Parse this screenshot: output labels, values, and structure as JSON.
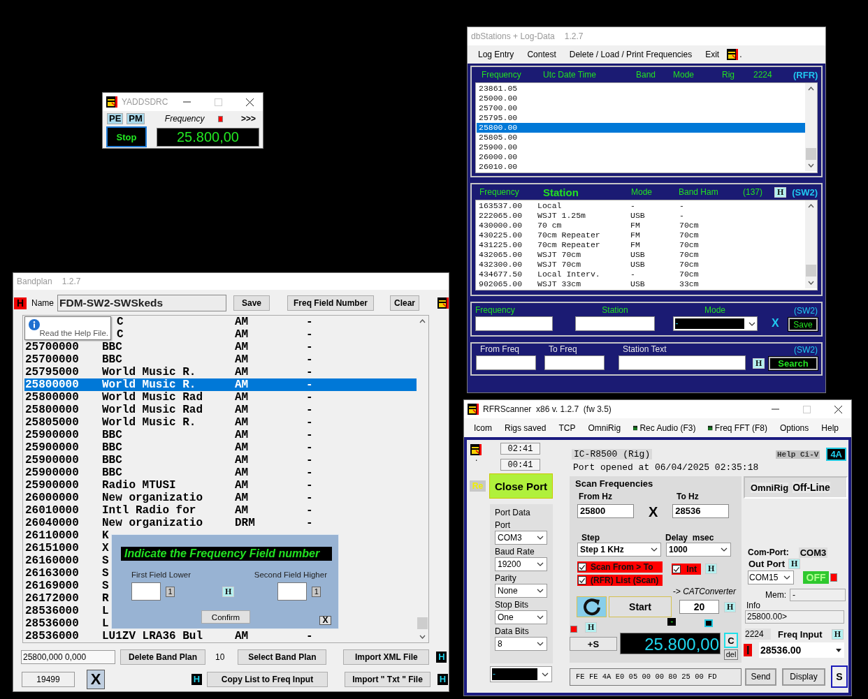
{
  "yaddsdrc": {
    "title": "YADDSDRC",
    "modes": [
      "PE",
      "PM"
    ],
    "frequency_label": "Frequency",
    "more": ">>>",
    "stop": "Stop",
    "frequency": "25.800,00"
  },
  "dbstations": {
    "title": "dbStations + Log-Data",
    "version": "1.2.7",
    "menu": [
      "Log Entry",
      "Contest",
      "Delete / Load / Print Frequencies",
      "Exit"
    ],
    "menu_mark": ".",
    "log": {
      "columns": [
        "Frequency",
        "Utc Date Time",
        "Band",
        "Mode",
        "Rig",
        "2224"
      ],
      "tag": "(RFR)",
      "rows": [
        {
          "frequency": "23861.05",
          "selected": false
        },
        {
          "frequency": "25000.00",
          "selected": false
        },
        {
          "frequency": "25700.00",
          "selected": false
        },
        {
          "frequency": "25795.00",
          "selected": false
        },
        {
          "frequency": "25800.00",
          "selected": true
        },
        {
          "frequency": "25805.00",
          "selected": false
        },
        {
          "frequency": "25900.00",
          "selected": false
        },
        {
          "frequency": "26000.00",
          "selected": false
        },
        {
          "frequency": "26010.00",
          "selected": false
        }
      ]
    },
    "stations": {
      "columns": [
        "Frequency",
        "Station",
        "Mode",
        "Band Ham",
        "(137)"
      ],
      "help": "H",
      "tag": "(SW2)",
      "rows": [
        {
          "frequency": "163537.00",
          "station": "Local",
          "mode": "-",
          "band": "-"
        },
        {
          "frequency": "222065.00",
          "station": "WSJT 1.25m",
          "mode": "USB",
          "band": "-"
        },
        {
          "frequency": "430000.00",
          "station": "70 cm",
          "mode": "FM",
          "band": "70cm"
        },
        {
          "frequency": "430225.00",
          "station": "70cm Repeater",
          "mode": "FM",
          "band": "70cm"
        },
        {
          "frequency": "431225.00",
          "station": "70cm Repeater",
          "mode": "FM",
          "band": "70cm"
        },
        {
          "frequency": "432065.00",
          "station": "WSJT 70cm",
          "mode": "USB",
          "band": "70cm"
        },
        {
          "frequency": "432300.00",
          "station": "WSJT 70cm",
          "mode": "USB",
          "band": "70cm"
        },
        {
          "frequency": "434677.50",
          "station": "Local Interv.",
          "mode": "-",
          "band": "70cm"
        },
        {
          "frequency": "902065.00",
          "station": "WSJT 33cm",
          "mode": "USB",
          "band": "33cm"
        }
      ]
    },
    "entry": {
      "frequency_label": "Frequency",
      "station_label": "Station",
      "mode_label": "Mode",
      "mode_value": "-",
      "clear": "X",
      "save": "Save",
      "tag": "(SW2)"
    },
    "search": {
      "from_label": "From Freq",
      "to_label": "To Freq",
      "text_label": "Station Text",
      "help": "H",
      "button": "Search",
      "tag": "(SW2)"
    }
  },
  "bandplan": {
    "title": "Bandplan",
    "version": "1.2.7",
    "help": "H",
    "name_label": "Name",
    "name_value": "FDM-SW2-SWSkeds",
    "buttons": [
      "Save",
      "Freq Field Number",
      "Clear"
    ],
    "rows": [
      {
        "station": "C",
        "mode": "AM",
        "band": "-",
        "selected": false
      },
      {
        "station": "C",
        "mode": "AM",
        "band": "-",
        "selected": false
      },
      {
        "frequency": "25700000",
        "station": "BBC",
        "mode": "AM",
        "band": "-",
        "selected": false
      },
      {
        "frequency": "25700000",
        "station": "BBC",
        "mode": "AM",
        "band": "-",
        "selected": false
      },
      {
        "frequency": "25795000",
        "station": "World Music R.",
        "mode": "AM",
        "band": "-",
        "selected": false
      },
      {
        "frequency": "25800000",
        "station": "World Music R.",
        "mode": "AM",
        "band": "-",
        "selected": true
      },
      {
        "frequency": "25800000",
        "station": "World Music Rad",
        "mode": "AM",
        "band": "-",
        "selected": false
      },
      {
        "frequency": "25800000",
        "station": "World Music Rad",
        "mode": "AM",
        "band": "-",
        "selected": false
      },
      {
        "frequency": "25805000",
        "station": "World Music R.",
        "mode": "AM",
        "band": "-",
        "selected": false
      },
      {
        "frequency": "25900000",
        "station": "BBC",
        "mode": "AM",
        "band": "-",
        "selected": false
      },
      {
        "frequency": "25900000",
        "station": "BBC",
        "mode": "AM",
        "band": "-",
        "selected": false
      },
      {
        "frequency": "25900000",
        "station": "BBC",
        "mode": "AM",
        "band": "-",
        "selected": false
      },
      {
        "frequency": "25900000",
        "station": "BBC",
        "mode": "AM",
        "band": "-",
        "selected": false
      },
      {
        "frequency": "25900000",
        "station": "Radio MTUSI",
        "mode": "AM",
        "band": "-",
        "selected": false
      },
      {
        "frequency": "26000000",
        "station": "New organizatio",
        "mode": "AM",
        "band": "-",
        "selected": false
      },
      {
        "frequency": "26010000",
        "station": "Intl Radio for",
        "mode": "AM",
        "band": "-",
        "selected": false
      },
      {
        "frequency": "26040000",
        "station": "New organizatio",
        "mode": "DRM",
        "band": "-",
        "selected": false
      },
      {
        "frequency": "26110000",
        "station": "K",
        "selected": false
      },
      {
        "frequency": "26151000",
        "station": "X",
        "selected": false
      },
      {
        "frequency": "26160000",
        "station": "S",
        "selected": false
      },
      {
        "frequency": "26163000",
        "station": "S",
        "selected": false
      },
      {
        "frequency": "26169000",
        "station": "S",
        "selected": false
      },
      {
        "frequency": "26172000",
        "station": "R",
        "selected": false
      },
      {
        "frequency": "28536000",
        "station": "L",
        "selected": false
      },
      {
        "frequency": "28536000",
        "station": "L",
        "selected": false
      },
      {
        "frequency": "28536000",
        "station": "LU1ZV LRA36 Bul",
        "mode": "AM",
        "band": "-",
        "selected": false
      }
    ],
    "tooltip": "Read the Help File.",
    "dialog": {
      "title": "Indicate the Frequency Field number",
      "lower_label": "First Field Lower",
      "higher_label": "Second Field Higher",
      "lower_spin": "1",
      "higher_spin": "1",
      "help": "H",
      "confirm": "Confirm",
      "close": "X"
    },
    "range": "25800,000 0,000",
    "delete": "Delete Band Plan",
    "count": "10",
    "select": "Select Band Plan",
    "import_xml": "Import XML File",
    "xml_help": "H",
    "total": "19499",
    "close": "X",
    "copy_help": "H",
    "copy": "Copy List to Freq Input",
    "import_txt": "Import \" Txt \" File",
    "txt_help": "H"
  },
  "rfrscanner": {
    "title": "RFRScanner  x86 v. 1.2.7  (fw 3.5)",
    "menu": [
      {
        "label": "Icom",
        "kind": "text"
      },
      {
        "label": "Rigs saved",
        "kind": "text"
      },
      {
        "label": "TCP",
        "kind": "text"
      },
      {
        "label": "OmniRig",
        "kind": "text"
      },
      {
        "label": "Rec Audio (F3)",
        "kind": "meter"
      },
      {
        "label": "Freq FFT (F8)",
        "kind": "meter"
      },
      {
        "label": "Options",
        "kind": "text"
      },
      {
        "label": "Help",
        "kind": "text"
      }
    ],
    "logo_mark": ".",
    "timers": [
      "02:41",
      "00:41"
    ],
    "re": "Re",
    "close_port": "Close Port",
    "port_data": {
      "title": "Port Data",
      "fields": [
        {
          "label": "Port",
          "value": "COM3"
        },
        {
          "label": "Baud Rate",
          "value": "19200"
        },
        {
          "label": "Parity",
          "value": "None"
        },
        {
          "label": "Stop Bits",
          "value": "One"
        },
        {
          "label": "Data Bits",
          "value": "8"
        }
      ]
    },
    "bottom_combo": "-",
    "rig": "IC-R8500 (Rig)",
    "status": "Port opened at 06/04/2025 02:35:18",
    "help_civ": "Help Ci-V",
    "address": "4A",
    "scan": {
      "title": "Scan Frequencies",
      "from_label": "From Hz",
      "from": "25800",
      "swap": "X",
      "to_label": "To Hz",
      "to": "28536",
      "step_label": "Step",
      "step": "Step 1 KHz",
      "delay_label": "Delay  msec",
      "delay": "1000",
      "options": [
        {
          "label": "Scan From > To",
          "checked": true
        },
        {
          "label": "(RFR) List (Scan)",
          "checked": true
        }
      ],
      "int": {
        "label": "Int",
        "checked": true
      },
      "int_help": "H",
      "cat": "-> CATConverter",
      "start": "Start",
      "count": "20",
      "count_help": "H",
      "s_help": "H",
      "signal_mark": "-",
      "s_button": "+S",
      "display": "25.800,00",
      "clear": "C",
      "delete": "del"
    },
    "omnirig": {
      "label": "OmniRig",
      "status": "Off-Line"
    },
    "com_port_label": "Com-Port:",
    "com_port": "COM3",
    "out_port_label": "Out Port",
    "out_help": "H",
    "out_port": "COM15",
    "out_state": "OFF",
    "mem_label": "Mem:",
    "mem": "-",
    "info_label": "Info",
    "info": "25800.00>",
    "channel": "2224",
    "freq_input_label": "Freq Input",
    "freq_help": "H",
    "freq_input": "28536.00",
    "command": "FE FE 4A E0 05 00 00 80 25 00 FD",
    "send": "Send",
    "display_button": "Display",
    "s": "S"
  }
}
